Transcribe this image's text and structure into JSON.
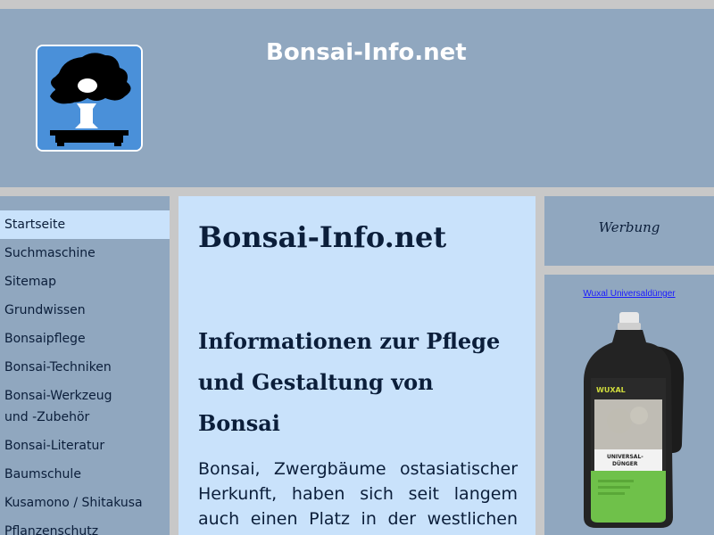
{
  "header": {
    "site_title": "Bonsai-Info.net"
  },
  "sidebar": {
    "items": [
      {
        "label": "Startseite",
        "active": true
      },
      {
        "label": "Suchmaschine"
      },
      {
        "label": "Sitemap"
      },
      {
        "label": "Grundwissen"
      },
      {
        "label": "Bonsaipflege"
      },
      {
        "label": "Bonsai-Techniken"
      },
      {
        "label": "Bonsai-Werkzeug",
        "label2": "und -Zubehör"
      },
      {
        "label": "Bonsai-Literatur"
      },
      {
        "label": "Baumschule"
      },
      {
        "label": "Kusamono / Shitakusa"
      },
      {
        "label": "Pflanzenschutz"
      }
    ]
  },
  "main": {
    "title": "Bonsai-Info.net",
    "subtitle_line1": "Informationen zur Pflege",
    "subtitle_line2": "und Gestaltung von",
    "subtitle_line3": "Bonsai",
    "intro": "Bonsai, Zwergbäume ostasiatischer Herkunft, haben sich seit langem auch einen Platz in der westlichen Welt erobert."
  },
  "ad": {
    "label": "Werbung",
    "link_text": "Wuxal Universaldünger",
    "product_brand": "WUXAL",
    "product_name_line1": "UNIVERSAL-",
    "product_name_line2": "DÜNGER"
  },
  "colors": {
    "page_bg": "#c8c8c8",
    "panel_blue": "#90a7bf",
    "light_blue": "#c9e2fb",
    "logo_blue": "#4a90d9",
    "text_dark": "#0b1e3a",
    "link_blue": "#1a1aff",
    "product_green": "#6fc14a"
  }
}
